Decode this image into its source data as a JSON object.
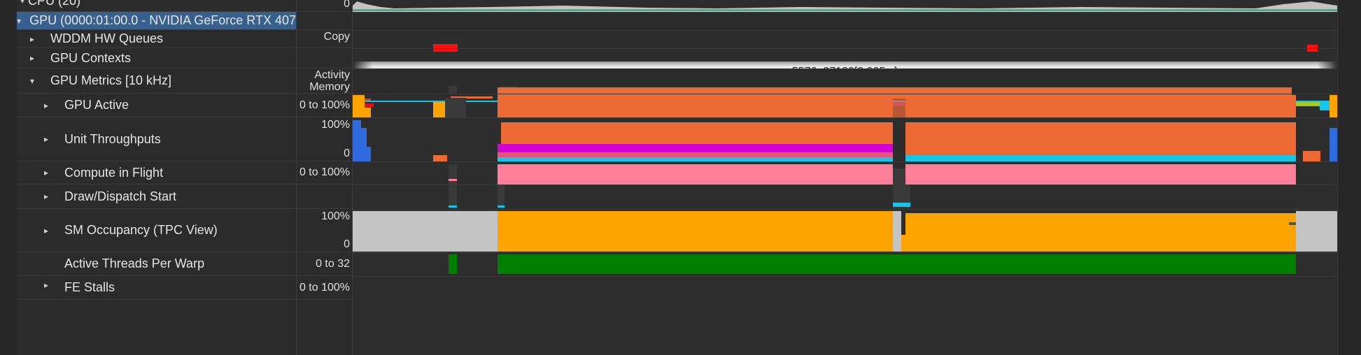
{
  "tree": {
    "rows": [
      {
        "label": "CPU (20)",
        "indent": 0,
        "expanded": true,
        "has_chevron": true
      },
      {
        "label": "GPU (0000:01:00.0 - NVIDIA GeForce RTX 407",
        "indent": 0,
        "expanded": true,
        "has_chevron": true,
        "selected": true
      },
      {
        "label": "WDDM HW Queues",
        "indent": 1,
        "expanded": false,
        "has_chevron": true
      },
      {
        "label": "GPU Contexts",
        "indent": 1,
        "expanded": false,
        "has_chevron": true
      },
      {
        "label": "GPU Metrics [10 kHz]",
        "indent": 1,
        "expanded": true,
        "has_chevron": true
      },
      {
        "label": "GPU Active",
        "indent": 2,
        "expanded": false,
        "has_chevron": true
      },
      {
        "label": "Unit Throughputs",
        "indent": 2,
        "expanded": false,
        "has_chevron": true
      },
      {
        "label": "Compute in Flight",
        "indent": 2,
        "expanded": false,
        "has_chevron": true
      },
      {
        "label": "Draw/Dispatch Start",
        "indent": 2,
        "expanded": false,
        "has_chevron": true
      },
      {
        "label": "SM Occupancy (TPC View)",
        "indent": 2,
        "expanded": false,
        "has_chevron": true
      },
      {
        "label": "Active Threads Per Warp",
        "indent": 2,
        "expanded": false,
        "has_chevron": false
      },
      {
        "label": "FE Stalls",
        "indent": 2,
        "expanded": false,
        "has_chevron": true
      }
    ]
  },
  "scale": {
    "cpu_min": "0",
    "hw_queues": "Copy",
    "metrics_activity": "Activity",
    "metrics_memory": "Memory",
    "gpu_active": "0 to 100%",
    "throughputs_max": "100%",
    "throughputs_min": "0",
    "compute_in_flight": "0 to 100%",
    "sm_occupancy_max": "100%",
    "sm_occupancy_min": "0",
    "threads_per_warp": "0 to 32",
    "fe_stalls": "0 to 100%"
  },
  "timeline": {
    "context_bar_label": "5576, 37120[2.925 s]"
  },
  "colors": {
    "selected_row": "#35608f",
    "orange": "#ee6a35",
    "amber": "#ffa300",
    "pink": "#ff7f98",
    "magenta": "#d400d4",
    "cyan": "#16c6e8",
    "blue": "#2f6bde",
    "green": "#008000",
    "red": "#ff1010",
    "lime": "#a8c81c",
    "purple": "#8a22b8"
  }
}
